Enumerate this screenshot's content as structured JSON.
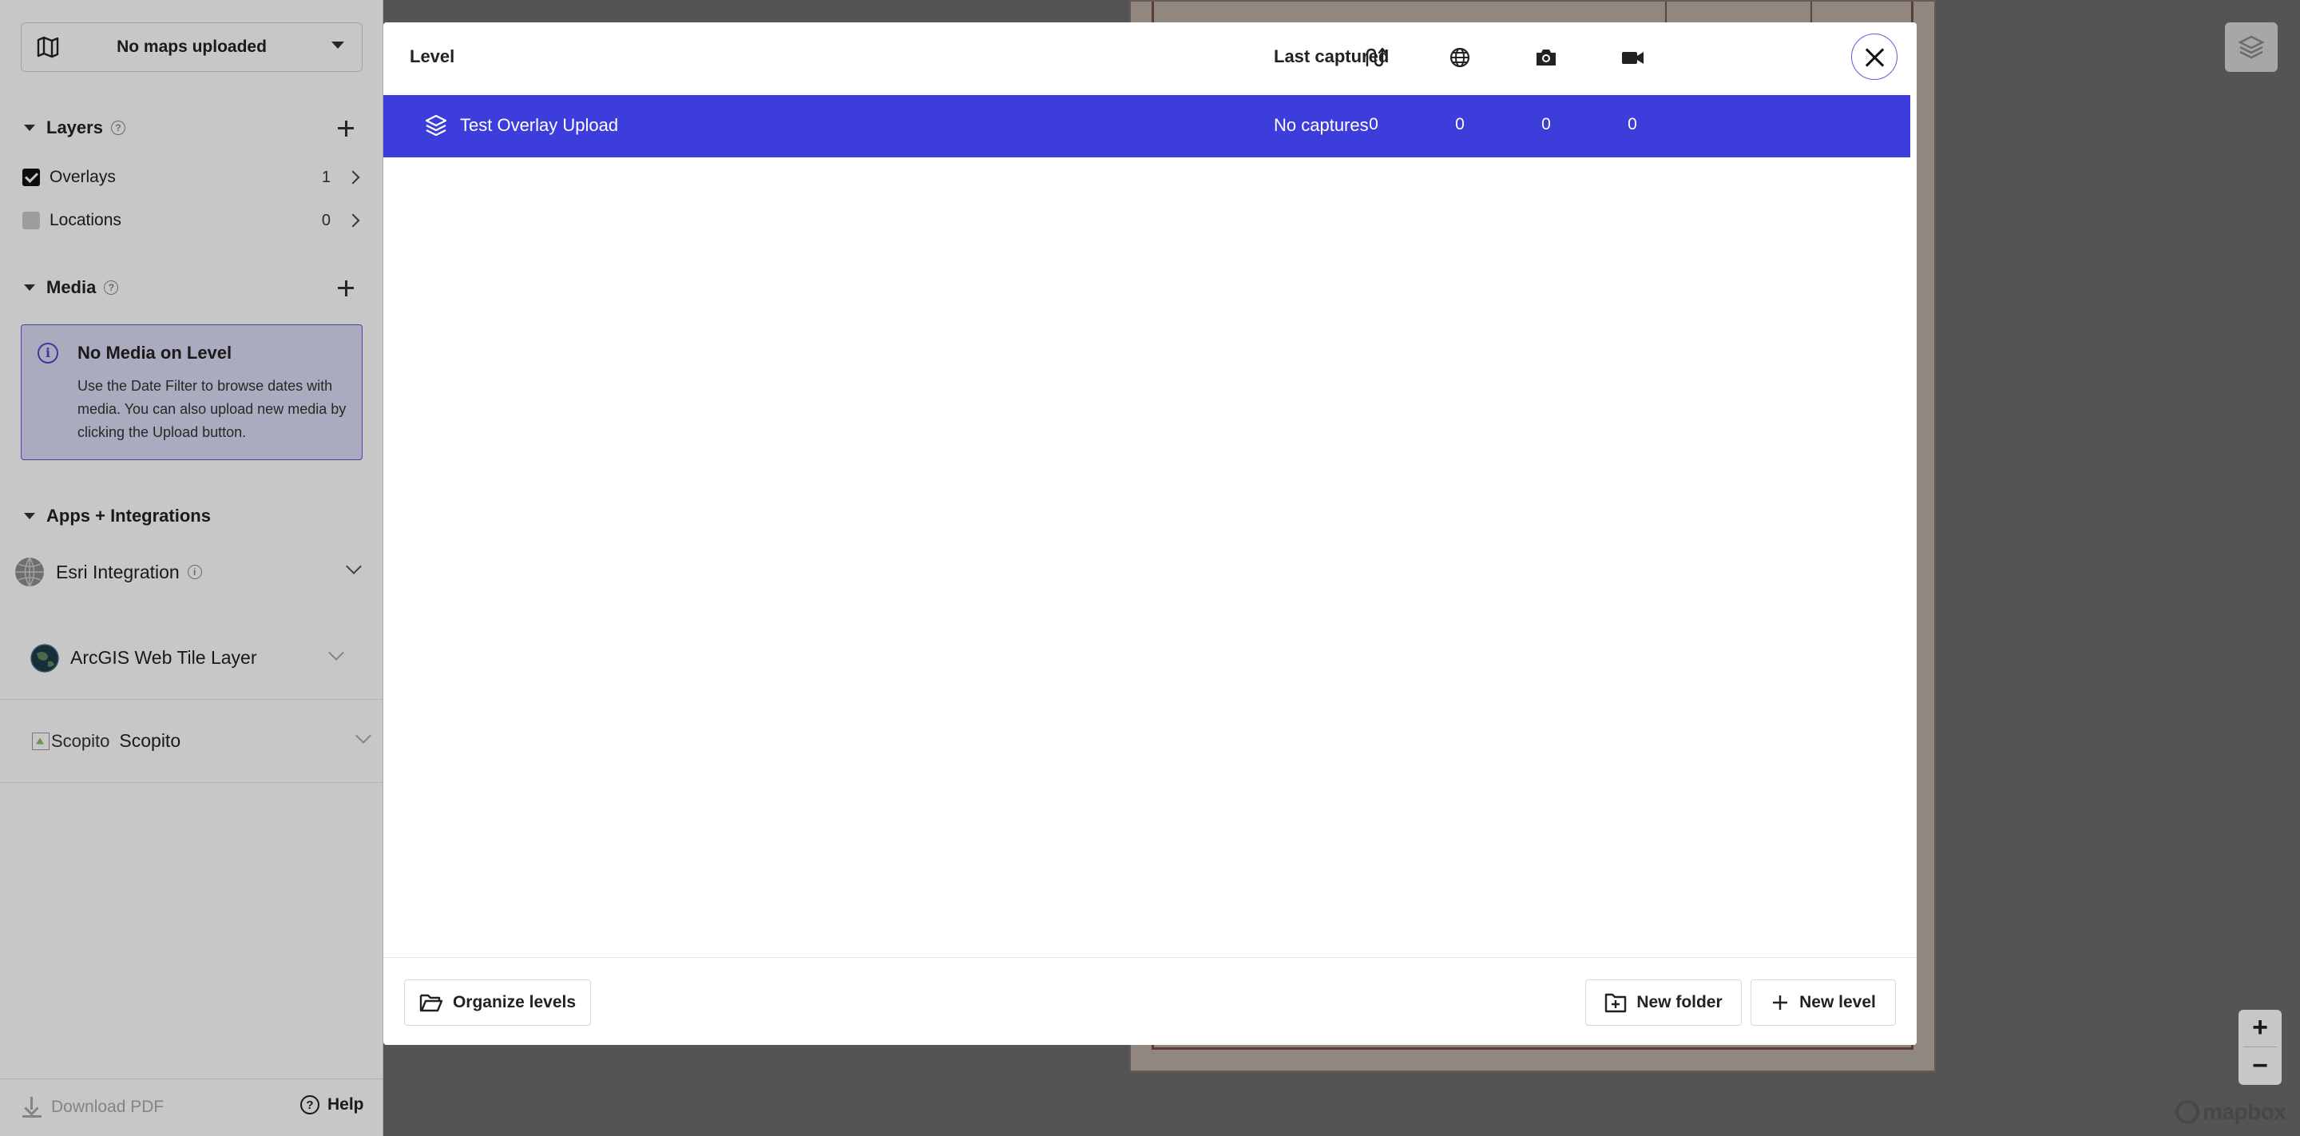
{
  "sidebar": {
    "map_select": {
      "label": "No maps uploaded"
    },
    "layers": {
      "title": "Layers",
      "help": "?",
      "items": [
        {
          "label": "Overlays",
          "count": "1",
          "checked": true
        },
        {
          "label": "Locations",
          "count": "0",
          "checked": false
        }
      ]
    },
    "media": {
      "title": "Media",
      "help": "?",
      "info_title": "No Media on Level",
      "info_body": "Use the Date Filter to browse dates with media. You can also upload new media by clicking the Upload button."
    },
    "apps": {
      "title": "Apps + Integrations",
      "esri": {
        "label": "Esri Integration",
        "help": "i"
      },
      "arcgis": {
        "label": "ArcGIS Web Tile Layer"
      },
      "scopito": {
        "alt": "Scopito",
        "label": "Scopito"
      }
    },
    "footer": {
      "download_pdf": "Download PDF",
      "help": "Help",
      "help_glyph": "?"
    }
  },
  "modal": {
    "columns": {
      "level": "Level",
      "last_captured": "Last captured"
    },
    "column_icons": [
      "route-icon",
      "globe-icon",
      "camera-icon",
      "video-camera-icon"
    ],
    "rows": [
      {
        "name": "Test Overlay Upload",
        "last_captured": "No captures",
        "route": "0",
        "globe": "0",
        "photos": "0",
        "videos": "0"
      }
    ],
    "footer": {
      "organize": "Organize levels",
      "new_folder": "New folder",
      "new_level": "New level"
    }
  },
  "map": {
    "zoom_in": "+",
    "zoom_out": "−",
    "attribution": "mapbox"
  },
  "colors": {
    "accent": "#3d3ddb",
    "info_bg": "#dcdcf5",
    "info_border": "#5a5ad8"
  }
}
